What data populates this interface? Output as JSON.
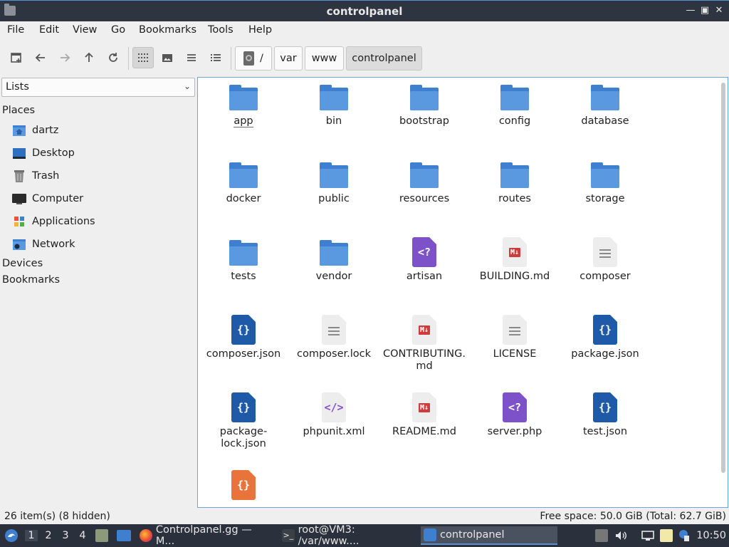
{
  "window": {
    "title": "controlpanel"
  },
  "menu": [
    "File",
    "Edit",
    "View",
    "Go",
    "Bookmarks",
    "Tools",
    "Help"
  ],
  "toolbar": {
    "buttons": [
      "new-tab",
      "back",
      "forward",
      "up",
      "reload",
      "icon-view",
      "thumbnail-view",
      "compact-view",
      "detailed-list-view"
    ],
    "breadcrumb": [
      "/",
      "var",
      "www",
      "controlpanel"
    ]
  },
  "sidebar": {
    "selector": "Lists",
    "places_label": "Places",
    "places": [
      {
        "label": "dartz",
        "icon": "home-folder-icon"
      },
      {
        "label": "Desktop",
        "icon": "desktop-icon"
      },
      {
        "label": "Trash",
        "icon": "trash-icon"
      },
      {
        "label": "Computer",
        "icon": "computer-icon"
      },
      {
        "label": "Applications",
        "icon": "applications-icon"
      },
      {
        "label": "Network",
        "icon": "network-icon"
      }
    ],
    "devices_label": "Devices",
    "bookmarks_label": "Bookmarks"
  },
  "files": [
    {
      "name": "app",
      "type": "folder"
    },
    {
      "name": "bin",
      "type": "folder"
    },
    {
      "name": "bootstrap",
      "type": "folder"
    },
    {
      "name": "config",
      "type": "folder"
    },
    {
      "name": "database",
      "type": "folder"
    },
    {
      "name": "docker",
      "type": "folder"
    },
    {
      "name": "public",
      "type": "folder"
    },
    {
      "name": "resources",
      "type": "folder"
    },
    {
      "name": "routes",
      "type": "folder"
    },
    {
      "name": "storage",
      "type": "folder"
    },
    {
      "name": "tests",
      "type": "folder"
    },
    {
      "name": "vendor",
      "type": "folder"
    },
    {
      "name": "artisan",
      "type": "php"
    },
    {
      "name": "BUILDING.md",
      "type": "md"
    },
    {
      "name": "composer",
      "type": "doc"
    },
    {
      "name": "composer.json",
      "type": "json"
    },
    {
      "name": "composer.lock",
      "type": "doc"
    },
    {
      "name": "CONTRIBUTING.\nmd",
      "type": "md"
    },
    {
      "name": "LICENSE",
      "type": "doc"
    },
    {
      "name": "package.json",
      "type": "json"
    },
    {
      "name": "package-\nlock.json",
      "type": "json"
    },
    {
      "name": "phpunit.xml",
      "type": "xml"
    },
    {
      "name": "README.md",
      "type": "md"
    },
    {
      "name": "server.php",
      "type": "php"
    },
    {
      "name": "test.json",
      "type": "json"
    },
    {
      "name": "",
      "type": "orange"
    }
  ],
  "status": {
    "items": "26 item(s) (8 hidden)",
    "free": "Free space: 50.0 GiB (Total: 62.7 GiB)"
  },
  "taskbar": {
    "workspaces": [
      "1",
      "2",
      "3",
      "4"
    ],
    "tasks": [
      {
        "label": "Controlpanel.gg — M...",
        "icon": "firefox-icon"
      },
      {
        "label": "root@VM3: /var/www....",
        "icon": "terminal-icon"
      },
      {
        "label": "controlpanel",
        "icon": "file-manager-icon"
      }
    ],
    "clock": "10:50"
  },
  "colors": {
    "folder": "#3f7fd0",
    "selection": "#6ea6d8",
    "titlebar": "#2e3440",
    "taskbar": "#2b313c"
  }
}
